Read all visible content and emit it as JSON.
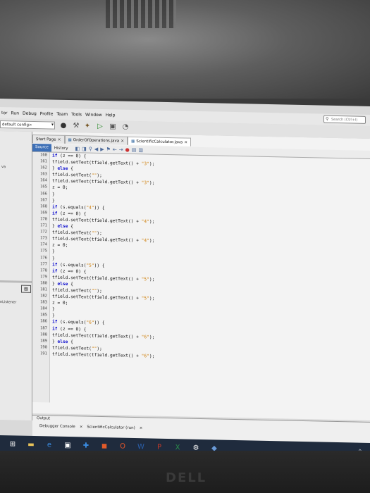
{
  "menu": {
    "items": [
      "tor",
      "Run",
      "Debug",
      "Profile",
      "Team",
      "Tools",
      "Window",
      "Help"
    ],
    "search_placeholder": "Search (Ctrl+I)"
  },
  "toolbar": {
    "config_value": "default config>"
  },
  "left_panel": {
    "label_top": "va",
    "label_bottom": "nListener"
  },
  "editor": {
    "tabs": [
      {
        "label": "Start Page",
        "active": false
      },
      {
        "label": "OrderOfOperations.java",
        "active": false
      },
      {
        "label": "ScientificCalculator.java",
        "active": true
      }
    ],
    "source_label": "Source",
    "history_label": "History"
  },
  "code": {
    "lines": [
      {
        "n": "160",
        "t": "if (z == 0) {"
      },
      {
        "n": "161",
        "t": "tfield.setText(tfield.getText() + \"3\");"
      },
      {
        "n": "162",
        "t": "} else {"
      },
      {
        "n": "163",
        "t": "tfield.setText(\"\");"
      },
      {
        "n": "164",
        "t": "tfield.setText(tfield.getText() + \"3\");"
      },
      {
        "n": "165",
        "t": "z = 0;"
      },
      {
        "n": "166",
        "t": "}"
      },
      {
        "n": "167",
        "t": "}"
      },
      {
        "n": "168",
        "t": "if (s.equals(\"4\")) {"
      },
      {
        "n": "169",
        "t": "if (z == 0) {"
      },
      {
        "n": "170",
        "t": "tfield.setText(tfield.getText() + \"4\");"
      },
      {
        "n": "171",
        "t": "} else {"
      },
      {
        "n": "172",
        "t": "tfield.setText(\"\");"
      },
      {
        "n": "173",
        "t": "tfield.setText(tfield.getText() + \"4\");"
      },
      {
        "n": "174",
        "t": "z = 0;"
      },
      {
        "n": "175",
        "t": "}"
      },
      {
        "n": "176",
        "t": "}"
      },
      {
        "n": "177",
        "t": "if (s.equals(\"5\")) {"
      },
      {
        "n": "178",
        "t": "if (z == 0) {"
      },
      {
        "n": "179",
        "t": "tfield.setText(tfield.getText() + \"5\");"
      },
      {
        "n": "180",
        "t": "} else {"
      },
      {
        "n": "181",
        "t": "tfield.setText(\"\");"
      },
      {
        "n": "182",
        "t": "tfield.setText(tfield.getText() + \"5\");"
      },
      {
        "n": "183",
        "t": "z = 0;"
      },
      {
        "n": "184",
        "t": "}"
      },
      {
        "n": "185",
        "t": "}"
      },
      {
        "n": "186",
        "t": "if (s.equals(\"6\")) {"
      },
      {
        "n": "187",
        "t": "if (z == 0) {"
      },
      {
        "n": "188",
        "t": "tfield.setText(tfield.getText() + \"6\");"
      },
      {
        "n": "189",
        "t": "} else {"
      },
      {
        "n": "190",
        "t": "tfield.setText(\"\");"
      },
      {
        "n": "191",
        "t": "tfield.setText(tfield.getText() + \"6\");"
      }
    ]
  },
  "output": {
    "title": "Output",
    "tabs": [
      "Debugger Console",
      "ScientificCalculator (run)"
    ]
  },
  "brand": "DELL"
}
